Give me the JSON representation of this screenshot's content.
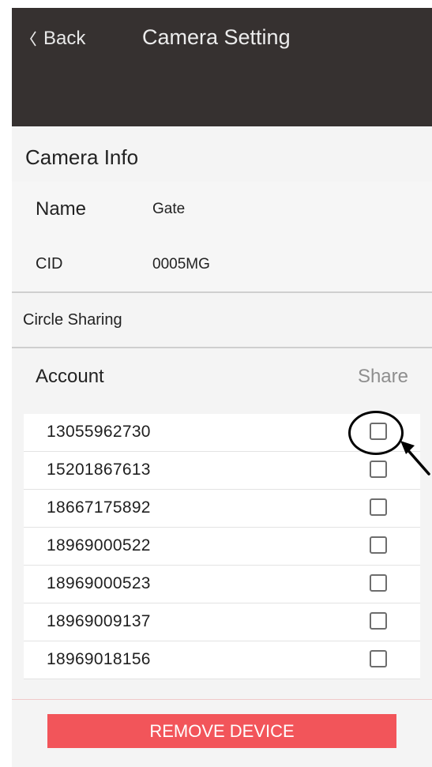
{
  "header": {
    "back_label": "Back",
    "title": "Camera Setting"
  },
  "camera_info": {
    "section_title": "Camera Info",
    "name_label": "Name",
    "name_value": "Gate",
    "cid_label": "CID",
    "cid_value": "0005MG"
  },
  "circle_sharing": {
    "section_title": "Circle Sharing",
    "account_header": "Account",
    "share_header": "Share",
    "accounts": [
      {
        "number": "13055962730",
        "shared": false
      },
      {
        "number": "15201867613",
        "shared": false
      },
      {
        "number": "18667175892",
        "shared": false
      },
      {
        "number": "18969000522",
        "shared": false
      },
      {
        "number": "18969000523",
        "shared": false
      },
      {
        "number": "18969009137",
        "shared": false
      },
      {
        "number": "18969018156",
        "shared": false
      }
    ]
  },
  "footer": {
    "remove_label": "REMOVE DEVICE"
  },
  "colors": {
    "header_bg": "#363130",
    "remove_button": "#f2555a",
    "annotation": "#000000"
  },
  "icons": {
    "back": "chevron-left-icon",
    "checkbox": "checkbox-unchecked-icon",
    "annotation_circle": "highlight-circle",
    "annotation_arrow": "pointer-arrow-icon"
  }
}
